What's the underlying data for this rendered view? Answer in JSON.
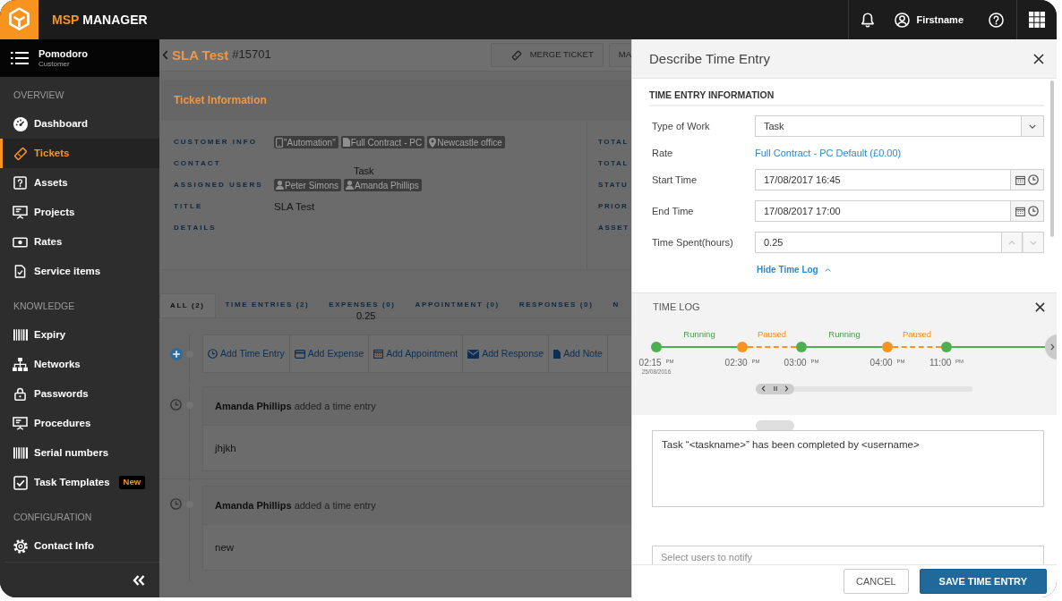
{
  "header": {
    "brand_prefix": "MSP",
    "brand_name": "MANAGER",
    "user_name": "Firstname"
  },
  "sidebar": {
    "customer": {
      "name": "Pomodoro",
      "role": "Customer"
    },
    "sections": [
      {
        "title": "OVERVIEW",
        "items": [
          {
            "label": "Dashboard",
            "selected": false
          },
          {
            "label": "Tickets",
            "selected": true
          },
          {
            "label": "Assets",
            "selected": false
          },
          {
            "label": "Projects",
            "selected": false
          },
          {
            "label": "Rates",
            "selected": false
          },
          {
            "label": "Service items",
            "selected": false
          }
        ]
      },
      {
        "title": "KNOWLEDGE",
        "items": [
          {
            "label": "Expiry",
            "selected": false
          },
          {
            "label": "Networks",
            "selected": false
          },
          {
            "label": "Passwords",
            "selected": false
          },
          {
            "label": "Procedures",
            "selected": false
          },
          {
            "label": "Serial numbers",
            "selected": false
          },
          {
            "label": "Task Templates",
            "selected": false,
            "badge": "New"
          }
        ]
      },
      {
        "title": "CONFIGURATION",
        "items": [
          {
            "label": "Contact Info",
            "selected": false
          }
        ]
      }
    ]
  },
  "ticket": {
    "title": "SLA Test",
    "number": "#15701",
    "actions": [
      "MERGE TICKET",
      "MA"
    ],
    "info_heading": "Ticket Information",
    "info_rows": [
      {
        "label": "CUSTOMER INFO",
        "chips": [
          "\"Automation\"",
          "Full Contract - PC",
          "Newcastle office"
        ]
      },
      {
        "label": "CONTACT"
      },
      {
        "label": "ASSIGNED USERS",
        "chips": [
          "Peter Simons",
          "Amanda Phillips"
        ]
      },
      {
        "label": "TITLE",
        "value": "SLA Test"
      },
      {
        "label": "DETAILS"
      }
    ],
    "side_labels": [
      "TOTAL",
      "TOTAL",
      "STATU",
      "PRIOR",
      "ASSET"
    ],
    "tabs": [
      {
        "label": "ALL (2)",
        "selected": true
      },
      {
        "label": "TIME ENTRIES (2)",
        "selected": false
      },
      {
        "label": "EXPENSES (0)",
        "selected": false
      },
      {
        "label": "APPOINTMENT (0)",
        "selected": false
      },
      {
        "label": "RESPONSES (0)",
        "selected": false
      },
      {
        "label": "N",
        "selected": false
      }
    ],
    "add_actions": [
      "Add Time Entry",
      "Add Expense",
      "Add Appointment",
      "Add Response",
      "Add Note"
    ],
    "entries": [
      {
        "text": "**Amanda Phillips** added a time entry",
        "body": "jhjkh"
      },
      {
        "text": "**Amanda Phillips** added a time entry",
        "body": "new"
      }
    ],
    "floating_texts": [
      "Task",
      "0.25"
    ]
  },
  "panel": {
    "title": "Describe Time Entry",
    "section": "TIME ENTRY INFORMATION",
    "fields": [
      {
        "label": "Type of Work",
        "kind": "select",
        "value": "Task"
      },
      {
        "label": "Rate",
        "kind": "link",
        "value": "Full Contract - PC Default (£0.00)"
      },
      {
        "label": "Start Time",
        "kind": "datetime",
        "value": "17/08/2017 16:45"
      },
      {
        "label": "End Time",
        "kind": "datetime",
        "value": "17/08/2017 17:00"
      },
      {
        "label": "Time Spent(hours)",
        "kind": "number",
        "value": "0.25"
      }
    ],
    "toggle": "Hide Time Log",
    "time_log": {
      "title": "TIME LOG",
      "points": [
        {
          "time": "02:15 $^{PM}$",
          "date": "25/08/2016",
          "kind": "running"
        },
        {
          "time": "02:30 $^{PM}$",
          "kind": "paused"
        },
        {
          "time": "03:00 $^{PM}$",
          "kind": "running"
        },
        {
          "time": "04:00 $^{PM}$",
          "kind": "paused"
        },
        {
          "time": "11:00 $^{PM}$",
          "kind": "running"
        }
      ],
      "segments": [
        {
          "label": "Running",
          "kind": "running"
        },
        {
          "label": "Paused",
          "kind": "paused"
        },
        {
          "label": "Running",
          "kind": "running"
        },
        {
          "label": "Paused",
          "kind": "paused"
        },
        {
          "kind": "running"
        }
      ]
    },
    "message": "Task “<taskname>” has been completed by <username>",
    "notify_placeholder": "Select users to notify",
    "buttons": [
      {
        "label": "CANCEL",
        "kind": "secondary"
      },
      {
        "label": "SAVE TIME ENTRY",
        "kind": "primary"
      }
    ]
  }
}
